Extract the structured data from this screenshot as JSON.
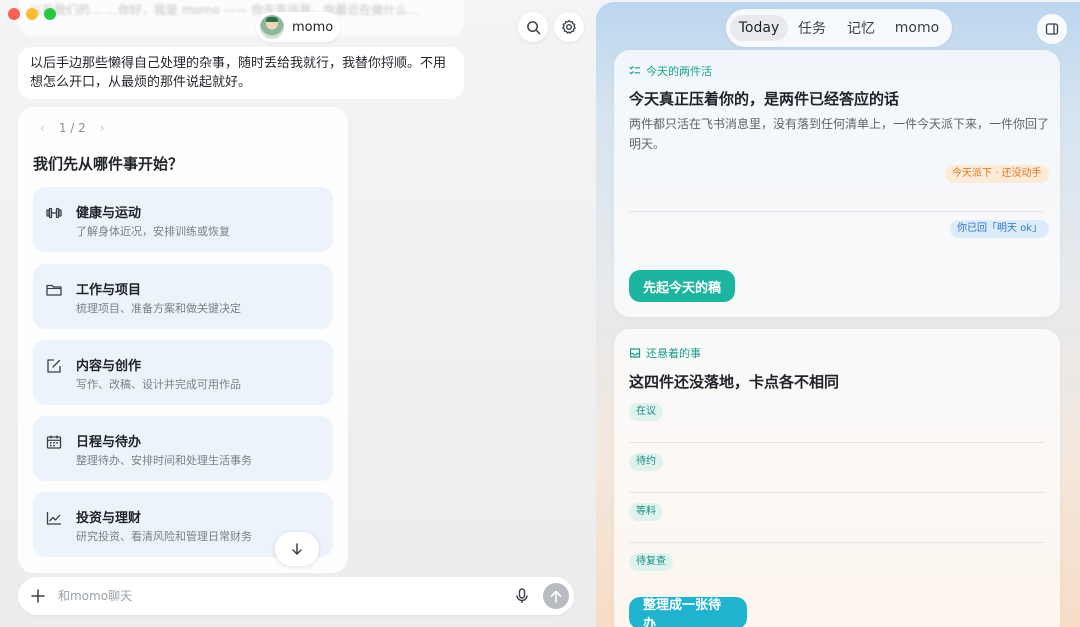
{
  "chat": {
    "assistant_name": "momo",
    "top_message_blurred": "以后我们的… …你好，我是 momo ——  你先告诉我，你最近在做什么…",
    "message": "以后手边那些懒得自己处理的杂事，随时丢给我就行，我替你捋顺。不用想怎么开口，从最烦的那件说起就好。",
    "pager": "1 / 2",
    "options_title": "我们先从哪件事开始？",
    "options": [
      {
        "title": "健康与运动",
        "desc": "了解身体近况，安排训练或恢复",
        "icon": "dumbbell-icon"
      },
      {
        "title": "工作与项目",
        "desc": "梳理项目、准备方案和做关键决定",
        "icon": "folder-icon"
      },
      {
        "title": "内容与创作",
        "desc": "写作、改稿、设计并完成可用作品",
        "icon": "edit-icon"
      },
      {
        "title": "日程与待办",
        "desc": "整理待办、安排时间和处理生活事务",
        "icon": "calendar-icon"
      },
      {
        "title": "投资与理财",
        "desc": "研究投资、看清风险和管理日常财务",
        "icon": "chart-line-icon"
      }
    ],
    "input_placeholder": "和momo聊天"
  },
  "panel": {
    "tabs": [
      "Today",
      "任务",
      "记忆",
      "momo"
    ],
    "active_tab": "Today",
    "card1": {
      "kicker": "今天的两件活",
      "heading": "今天真正压着你的，是两件已经答应的话",
      "desc": "两件都只活在飞书消息里，没有落到任何清单上，一件今天派下来，一件你回了明天。",
      "tag1": "今天派下 · 还没动手",
      "tag2": "你已回「明天 ok」",
      "button": "先起今天的稿"
    },
    "card2": {
      "kicker": "还悬着的事",
      "heading": "这四件还没落地，卡点各不相同",
      "tags": [
        "在议",
        "待约",
        "等料",
        "待复查"
      ],
      "button": "整理成一张待办"
    }
  },
  "colors": {
    "accent_teal": "#1db5a0",
    "tag_orange": "#d9772a",
    "tag_blue": "#2e74c8"
  }
}
